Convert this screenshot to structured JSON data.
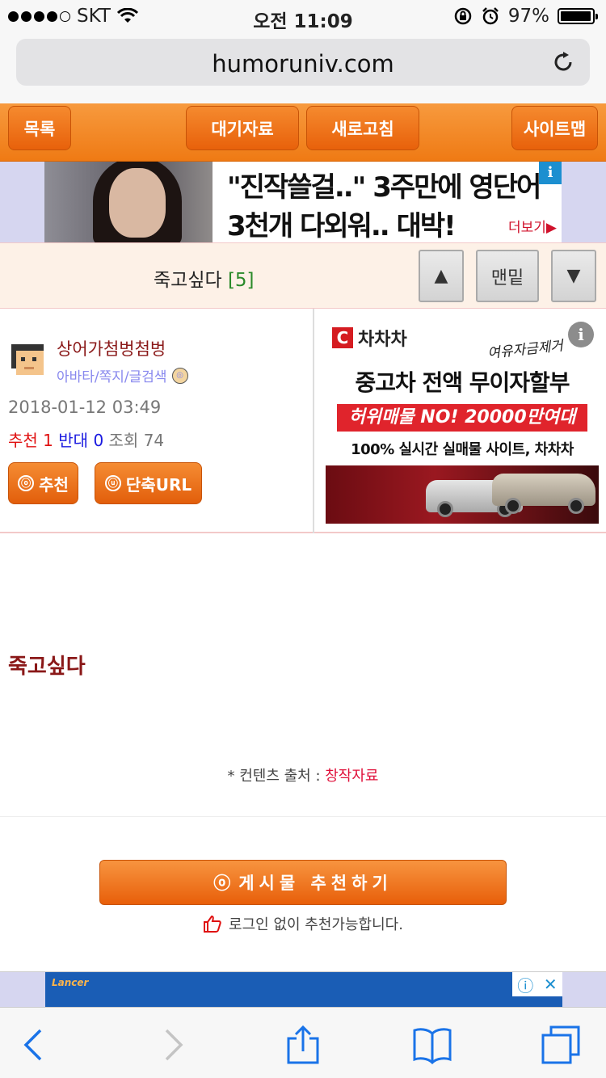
{
  "status_bar": {
    "carrier": "SKT",
    "time": "오전 11:09",
    "battery": "97%",
    "battery_level": 0.97
  },
  "browser": {
    "url": "humoruniv.com",
    "reload_icon": "reload-icon"
  },
  "site_nav": {
    "list_label": "목록",
    "waiting_label": "대기자료",
    "refresh_label": "새로고침",
    "sitemap_label": "사이트맵"
  },
  "top_ad": {
    "line1": "\"진작쓸걸..\" 3주만에 영단어",
    "line2": "3천개 다외워.. 대박!",
    "more": "더보기▶",
    "info_icon": "info-icon"
  },
  "title_bar": {
    "title": "죽고싶다",
    "comment_count": "[5]",
    "up_label": "▲",
    "bottom_label": "맨밑",
    "down_label": "▼"
  },
  "author": {
    "nickname": "상어가첨벙첨벙",
    "links": "아바타/쪽지/글검색",
    "date": "2018-01-12 03:49",
    "recommend_label": "추천",
    "recommend_count": "1",
    "oppose_label": "반대",
    "oppose_count": "0",
    "views_label": "조회",
    "views_count": "74",
    "recommend_button": "추천",
    "shorturl_button": "단축URL",
    "recommend_button_mark": "ⓞ",
    "shorturl_button_mark": "ⓤ"
  },
  "car_ad": {
    "brand": "차차차",
    "brand_logo": "C",
    "script": "여유자금제거",
    "headline": "중고차 전액 무이자할부",
    "band": "허위매물 NO! 20000만여대",
    "sub": "100% 실시간 실매물 사이트, 차차차",
    "info": "i"
  },
  "post": {
    "body": "죽고싶다",
    "source_label": "* 컨텐츠 출처 : ",
    "source_value": "창작자료"
  },
  "recommend": {
    "button_mark": "ⓞ",
    "button_label": "게시물 추천하기",
    "note": "로그인 없이 추천가능합니다."
  },
  "bottom_ad": {
    "brand": "Lancer",
    "info": "ⓘ",
    "close": "✕"
  }
}
